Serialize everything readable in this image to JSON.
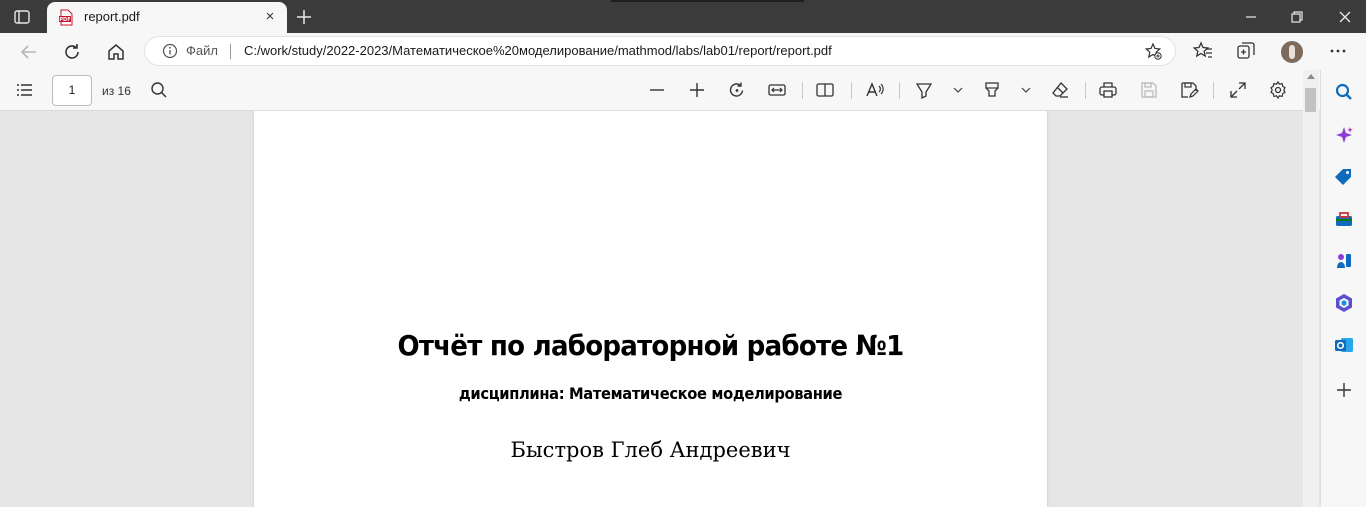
{
  "browser": {
    "tab_title": "report.pdf",
    "tab_close": "×",
    "colors": {
      "titlebar": "#3b3b3b",
      "tab_active": "#f7f7f7",
      "pdf_icon": "#c8102e"
    }
  },
  "address_bar": {
    "scheme_label": "Файл",
    "url": "C:/work/study/2022-2023/Математическое%20моделирование/mathmod/labs/lab01/report/report.pdf",
    "icons": [
      "back-icon",
      "refresh-icon",
      "home-icon",
      "info-icon",
      "add-favorite-icon",
      "favorites-icon",
      "collections-icon",
      "profile-avatar",
      "more-icon"
    ]
  },
  "pdf_toolbar": {
    "current_page": "1",
    "page_count": "из 16",
    "icons": [
      "contents-icon",
      "search-icon",
      "zoom-out-icon",
      "zoom-in-icon",
      "rotate-icon",
      "fit-width-icon",
      "page-view-icon",
      "read-aloud-icon",
      "draw-icon",
      "highlight-icon",
      "erase-icon",
      "print-icon",
      "save-icon",
      "save-as-icon",
      "fullscreen-icon",
      "settings-icon"
    ]
  },
  "document": {
    "title": "Отчёт по лабораторной работе №1",
    "subtitle": "дисциплина: Математическое моделирование",
    "author": "Быстров Глеб Андреевич"
  },
  "sidebar": {
    "icons": [
      "search-icon",
      "copilot-icon",
      "shopping-icon",
      "tools-icon",
      "games-icon",
      "office-icon",
      "outlook-icon",
      "add-icon"
    ],
    "colors": {
      "blue": "#0f6cbd",
      "purple": "#8b3fd9",
      "red": "#d13438",
      "green": "#107c10"
    }
  }
}
